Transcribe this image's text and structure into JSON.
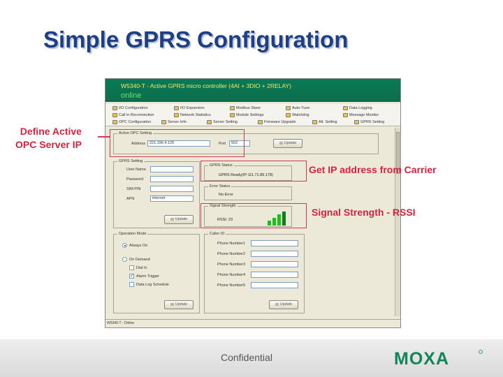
{
  "slide": {
    "title": "Simple GPRS Configuration",
    "footer": "Confidential",
    "logo_text": "MOXA"
  },
  "app": {
    "title": "W5340-T - Active GPRS micro controller (4AI + 3DIO + 2RELAY)",
    "status": "online",
    "nav_row1": [
      "I/O Configuration",
      "I/O Expansion",
      "Modbus Slave",
      "Auto-Tune",
      "Data Logging"
    ],
    "nav_row2": [
      "Call in Reconnection",
      "Network Statistics",
      "Module Settings",
      "Watchdog",
      "Message Monitor"
    ],
    "nav_row3": [
      "OPC Configuration",
      "Server Info",
      "Server Setting",
      "Firmware Upgrade",
      "Alt. Setting",
      "GPRS Setting"
    ],
    "statusbar": "W5340-T : Online"
  },
  "active_opc": {
    "title": "Active OPC Setting",
    "address_label": "Address",
    "address_value": "221.196.4.120",
    "port_label": "Port",
    "port_value": "502",
    "update_label": "Update"
  },
  "gprs": {
    "title": "GPRS Setting",
    "username_label": "User Name",
    "password_label": "Password",
    "sim_pin_label": "SIM PIN",
    "apn_label": "APN",
    "apn_value": "internet",
    "update_label": "Update"
  },
  "gprs_status": {
    "title": "GPRS Status",
    "value": "GPRS Ready(IP:111.71.89.178)"
  },
  "error_status": {
    "title": "Error Status",
    "value": "No Error"
  },
  "signal": {
    "title": "Signal Strength",
    "rssi_label": "RSSI: 23",
    "level_fraction": 0.74
  },
  "operation": {
    "title": "Operation Mode",
    "always_on": "Always On",
    "on_demand": "On Demand",
    "opt1": "Dial In",
    "opt2": "Alarm Trigger",
    "opt3": "Data Log Schedule",
    "update_label": "Update"
  },
  "callin": {
    "title": "Caller ID",
    "labels": [
      "Phone Number1",
      "Phone Number2",
      "Phone Number3",
      "Phone Number4",
      "Phone Number5"
    ],
    "update_label": "Update"
  },
  "callouts": {
    "opc": "Define Active\nOPC Server IP",
    "carrier": "Get IP address from Carrier",
    "rssi": "Signal Strength - RSSI"
  },
  "colors": {
    "title": "#1e3f86",
    "callout": "#d2233f",
    "app_header": "#0a7a56",
    "signal": "#19c11f"
  }
}
